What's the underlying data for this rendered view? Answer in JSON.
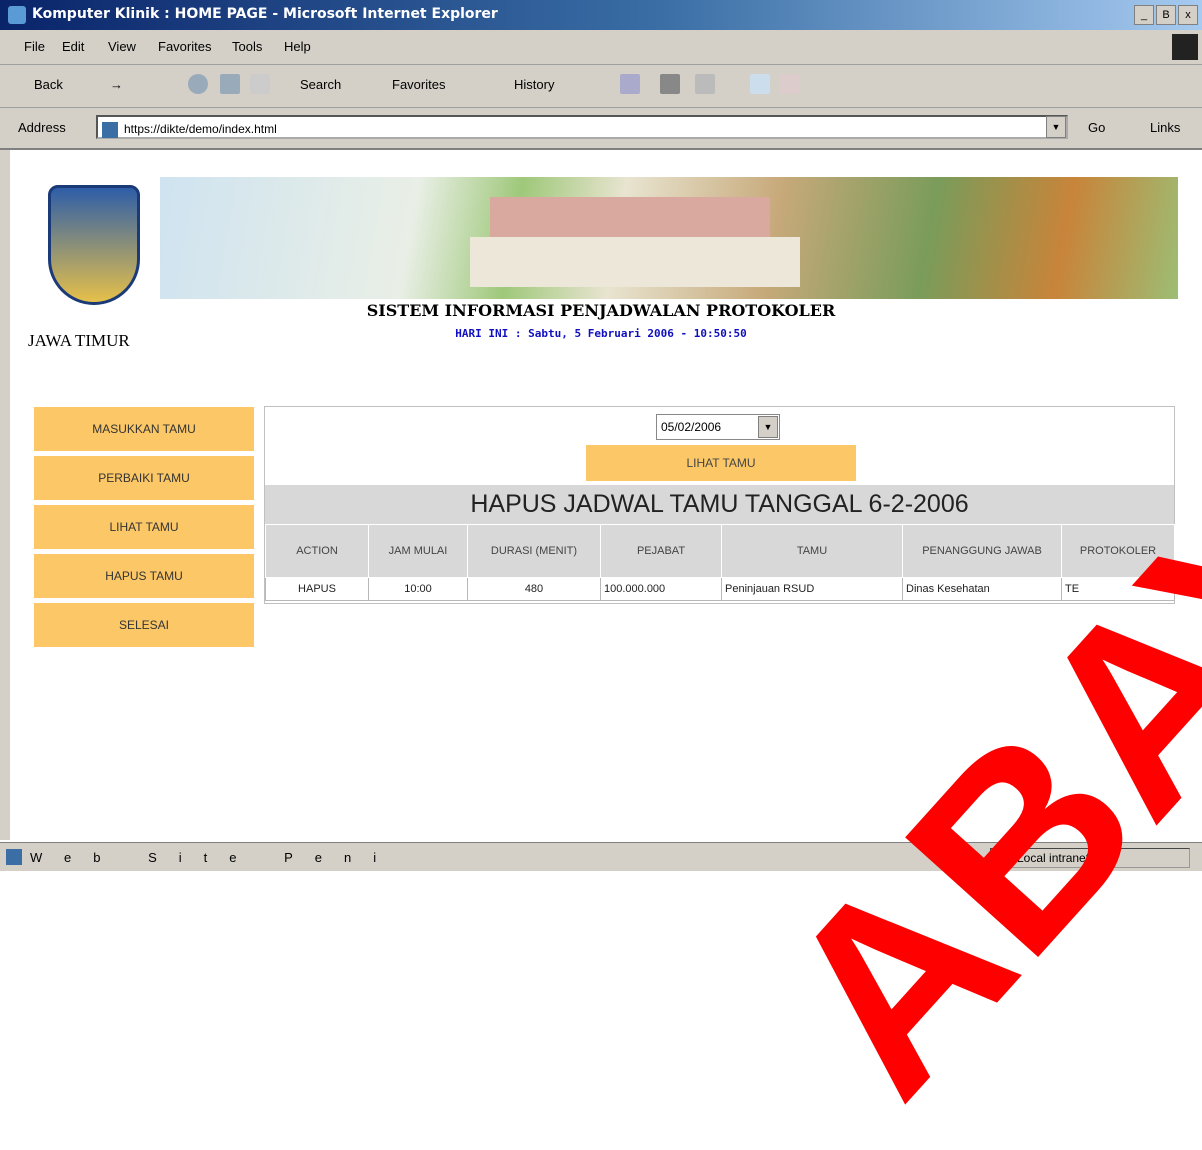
{
  "window": {
    "title": "Komputer Klinik : HOME PAGE - Microsoft Internet Explorer",
    "controls": [
      "_",
      "Β",
      "x"
    ]
  },
  "menubar": [
    "File",
    "Edit",
    "View",
    "Favorites",
    "Tools",
    "Help"
  ],
  "toolbar": {
    "back": "Back",
    "search": "Search",
    "favorites": "Favorites",
    "history": "History"
  },
  "address": {
    "label": "Address",
    "url": "https://dikte/demo/index.html",
    "go": "Go",
    "links": "Links"
  },
  "page": {
    "region": "JAWA TIMUR",
    "system_name": "SISTEM INFORMASI PENJADWALAN PROTOKOLER",
    "today": "HARI INI : Sabtu, 5 Februari 2006 - 10:50:50",
    "menu": [
      "MASUKKAN TAMU",
      "PERBAIKI TAMU",
      "LIHAT TAMU",
      "HAPUS TAMU",
      "SELESAI"
    ],
    "date_select": "05/02/2006",
    "lihat_button": "LIHAT TAMU",
    "heading": "HAPUS JADWAL TAMU TANGGAL 6-2-2006",
    "columns": [
      "ACTION",
      "JAM MULAI",
      "DURASI (MENIT)",
      "PEJABAT",
      "TAMU",
      "PENANGGUNG JAWAB",
      "PROTOKOLER"
    ],
    "rows": [
      [
        "HAPUS",
        "10:00",
        "480",
        "100.000.000",
        "Peninjauan RSUD",
        "Dinas Kesehatan",
        "TE"
      ]
    ]
  },
  "status": {
    "text": "Web Site Peni",
    "zone": "Local intranet"
  },
  "watermark": "ABAYA"
}
